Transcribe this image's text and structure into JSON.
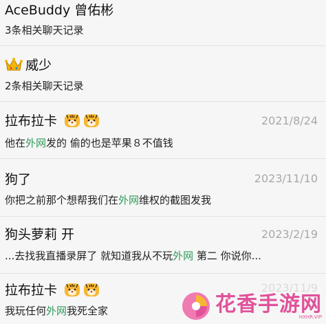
{
  "results": [
    {
      "name": "AceBuddy 曾佑彬",
      "emoji": [],
      "date": "",
      "parts": [
        {
          "t": "3条相关聊天记录"
        }
      ]
    },
    {
      "name": "威少",
      "prefix_emoji": "crown",
      "emoji": [],
      "date": "",
      "parts": [
        {
          "t": "2条相关聊天记录"
        }
      ]
    },
    {
      "name": "拉布拉卡",
      "emoji": [
        "tiger",
        "tiger"
      ],
      "date": "2021/8/24",
      "parts": [
        {
          "t": "他在"
        },
        {
          "t": "外网",
          "hl": true
        },
        {
          "t": "发的 偷的也是苹果８不值钱"
        }
      ]
    },
    {
      "name": "狗了",
      "emoji": [],
      "date": "2023/11/10",
      "parts": [
        {
          "t": "你把之前那个想帮我们在"
        },
        {
          "t": "外网",
          "hl": true
        },
        {
          "t": "维权的截图发我"
        }
      ]
    },
    {
      "name": "狗头萝莉 开",
      "emoji": [],
      "date": "2023/2/19",
      "parts": [
        {
          "t": "...去找我直播录屏了 就知道我从不玩"
        },
        {
          "t": "外网",
          "hl": true
        },
        {
          "t": " 第二 你说你..."
        }
      ]
    },
    {
      "name": "拉布拉卡",
      "emoji": [
        "tiger",
        "tiger"
      ],
      "date": "2023/11/9",
      "parts": [
        {
          "t": "我玩任何"
        },
        {
          "t": "外网",
          "hl": true
        },
        {
          "t": "我死全家"
        }
      ]
    }
  ],
  "watermark": {
    "text": "花香手游网",
    "url": "HXHR.VIP"
  },
  "colors": {
    "highlight": "#2f9a5a",
    "date": "#a8a8a8",
    "watermark": "#e0529a"
  }
}
